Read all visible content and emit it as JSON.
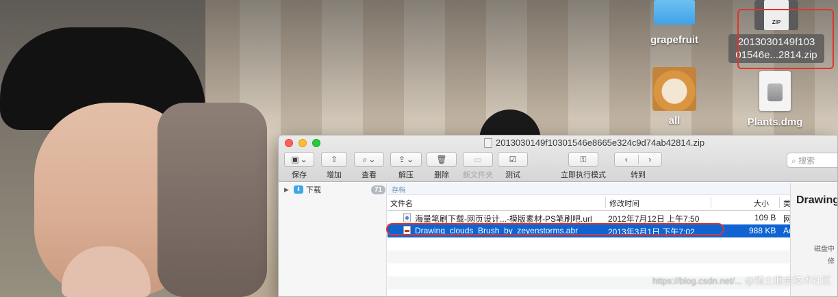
{
  "desktop": {
    "icons": [
      {
        "label": "grapefruit"
      },
      {
        "label": "2013030149f10301546e...2814.zip",
        "line1": "2013030149f103",
        "line2": "01546e...2814.zip",
        "badge": "ZIP"
      },
      {
        "label": "all"
      },
      {
        "label": "Plants.dmg"
      }
    ]
  },
  "window": {
    "title": "2013030149f10301546e8665e324c9d74ab42814.zip",
    "toolbar": {
      "save": "保存",
      "add": "增加",
      "view": "查看",
      "extract": "解压",
      "delete": "删除",
      "new_folder": "新文件夹",
      "test": "测试",
      "immediate_mode": "立即执行模式",
      "goto": "转到"
    },
    "search_placeholder": "搜索",
    "sidebar": {
      "items": [
        {
          "label": "下载",
          "count": "71"
        }
      ]
    },
    "pathbar": "存档",
    "columns": {
      "name": "文件名",
      "modified": "修改时间",
      "size": "大小",
      "kind": "类"
    },
    "rows": [
      {
        "name": "海量笔刷下载-网页设计...-模版素材-PS笔刷吧.url",
        "modified": "2012年7月12日 上午7:50",
        "size": "109 B",
        "kind": "网"
      },
      {
        "name": "Drawing_clouds_Brush_by_zeyenstorms.abr",
        "modified": "2013年3月1日 下午7:02",
        "size": "988 KB",
        "kind": "Ad",
        "selected": true
      }
    ],
    "preview": {
      "title": "Drawing",
      "info1": "磁盘中",
      "info2": "修"
    }
  },
  "watermark": {
    "url": "https://blog.csdn.net/...",
    "text": "@稀土掘金技术社区"
  },
  "colors": {
    "selection": "#0f64d2",
    "highlight": "#e0352b"
  }
}
